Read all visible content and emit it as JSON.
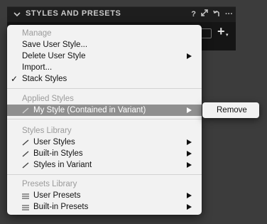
{
  "panel": {
    "title": "STYLES AND PRESETS",
    "help": "?",
    "more": "···",
    "add_button": "+"
  },
  "menu": {
    "manage_header": "Manage",
    "save_user_style": "Save User Style...",
    "delete_user_style": "Delete User Style",
    "import": "Import...",
    "stack_styles": "Stack Styles",
    "stack_styles_checked": "✓",
    "applied_header": "Applied Styles",
    "my_style": "My Style (Contained in Variant)",
    "library_header": "Styles Library",
    "user_styles": "User Styles",
    "builtin_styles": "Built-in Styles",
    "styles_in_variant": "Styles in Variant",
    "presets_header": "Presets Library",
    "user_presets": "User Presets",
    "builtin_presets": "Built-in Presets"
  },
  "submenu": {
    "remove": "Remove"
  },
  "icons": {
    "style_item": "brush-icon",
    "preset_item": "list-lines-icon"
  },
  "colors": {
    "menu_bg": "#f2f2f2",
    "highlight": "#8f8f8f",
    "header_text": "#9b9b9b",
    "panel_bg": "#1e1e1e"
  }
}
